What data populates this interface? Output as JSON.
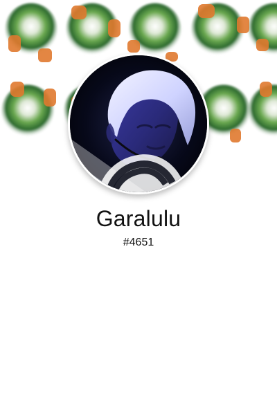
{
  "profile": {
    "username": "Garalulu",
    "discriminator": "#4651"
  },
  "banner": {
    "pattern": "green-orange-mosaic",
    "colors": {
      "green": "#6aa84f",
      "dark_green": "#2d6a2f",
      "orange": "#e07a2f",
      "white": "#ffffff"
    }
  },
  "avatar": {
    "description_icon": "profile-photo",
    "ring_color": "#ffffff"
  },
  "colors": {
    "text": "#111111",
    "background": "#ffffff"
  }
}
